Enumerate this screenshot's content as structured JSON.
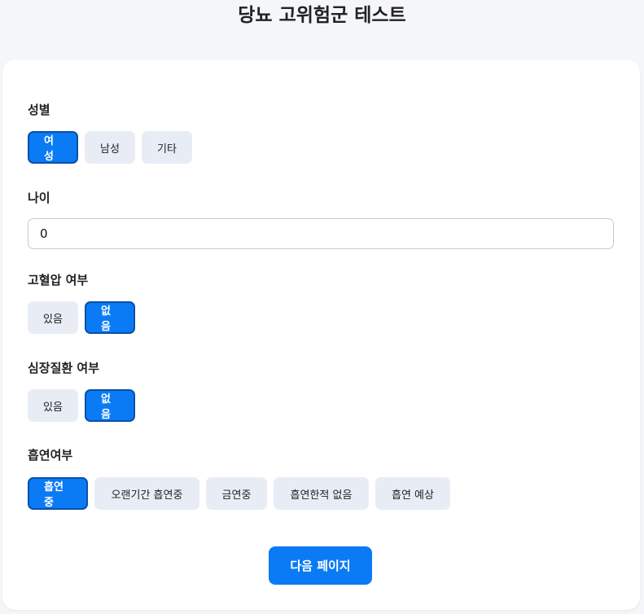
{
  "title": "당뇨 고위험군 테스트",
  "gender": {
    "label": "성별",
    "options": [
      "여성",
      "남성",
      "기타"
    ],
    "selected": "여성"
  },
  "age": {
    "label": "나이",
    "value": "0"
  },
  "hypertension": {
    "label": "고혈압 여부",
    "options": [
      "있음",
      "없음"
    ],
    "selected": "없음"
  },
  "heart_disease": {
    "label": "심장질환 여부",
    "options": [
      "있음",
      "없음"
    ],
    "selected": "없음"
  },
  "smoking": {
    "label": "흡연여부",
    "options": [
      "흡연중",
      "오랜기간 흡연중",
      "금연중",
      "흡연한적 없음",
      "흡연 예상"
    ],
    "selected": "흡연중"
  },
  "next_button": "다음 페이지",
  "colors": {
    "accent": "#0a7bf5",
    "accent_border": "#0a4fa8",
    "option_bg": "#e8edf5",
    "page_bg": "#f4f6fa"
  }
}
